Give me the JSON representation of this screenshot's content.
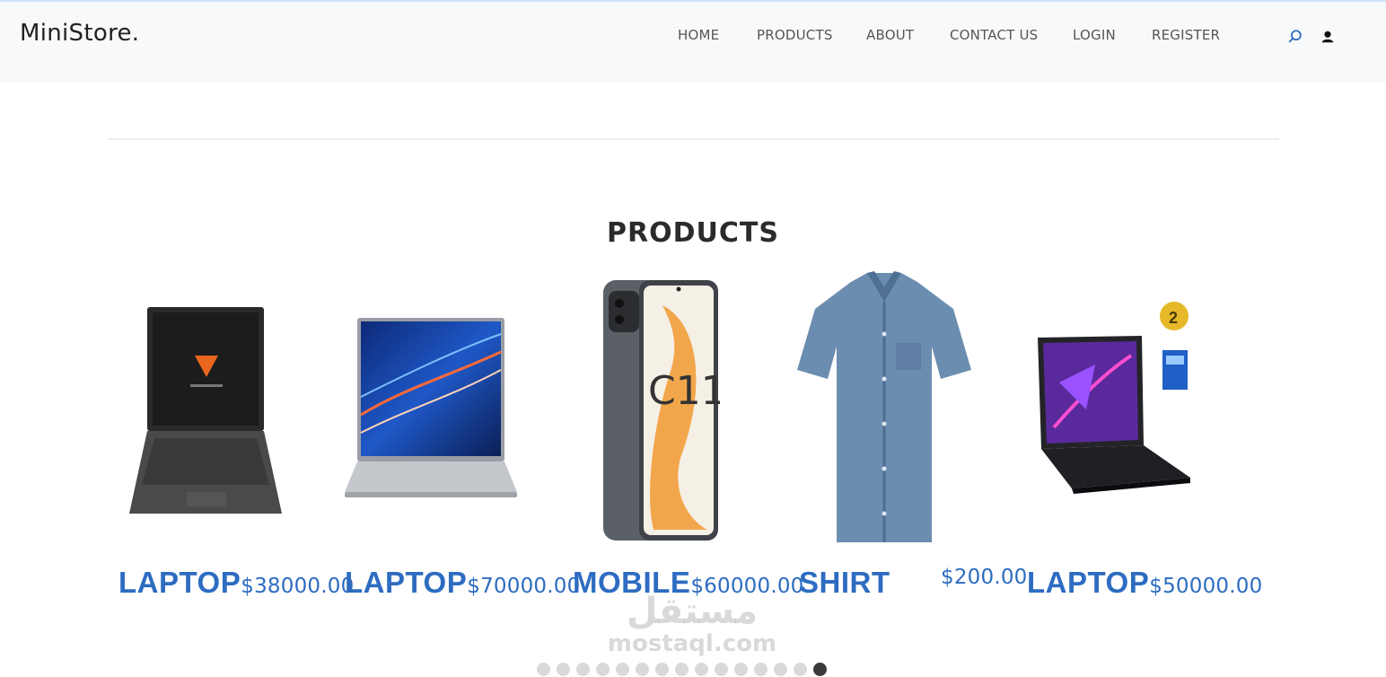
{
  "header": {
    "logo": "MiniStore",
    "nav": [
      {
        "label": "HOME"
      },
      {
        "label": "PRODUCTS"
      },
      {
        "label": "ABOUT"
      },
      {
        "label": "CONTACT US"
      },
      {
        "label": "LOGIN"
      },
      {
        "label": "REGISTER"
      }
    ],
    "icons": {
      "search": "search-icon",
      "user": "user-icon"
    }
  },
  "main": {
    "title": "PRODUCTS",
    "products": [
      {
        "name": "LAPTOP",
        "price": "$38000.00"
      },
      {
        "name": "LAPTOP",
        "price": "$70000.00"
      },
      {
        "name": "MOBILE",
        "price": "$60000.00"
      },
      {
        "name": "SHIRT",
        "price": "$200.00"
      },
      {
        "name": "LAPTOP",
        "price": "$50000.00"
      }
    ],
    "carousel": {
      "dot_count": 15,
      "active_dot": 15
    }
  },
  "watermark": {
    "arabic": "مستقل",
    "latin": "mostaql.com"
  },
  "colors": {
    "accent": "#2d6cc1",
    "header_bg": "#f8f9fa",
    "text": "#555555"
  }
}
